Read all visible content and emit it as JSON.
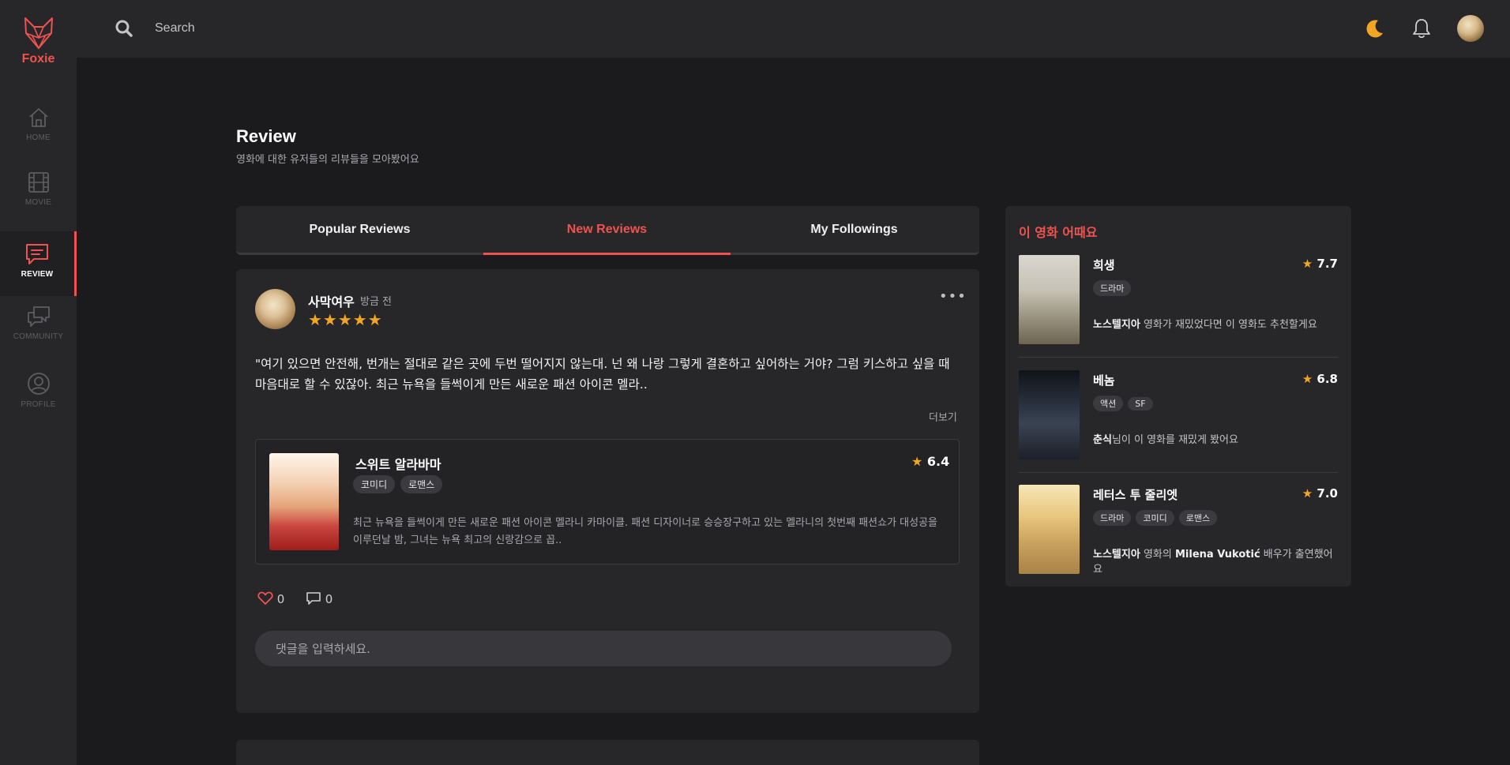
{
  "app": {
    "name": "Foxie"
  },
  "nav": {
    "home": "HOME",
    "movie": "MOVIE",
    "review": "REVIEW",
    "community": "COMMUNITY",
    "profile": "PROFILE"
  },
  "search": {
    "placeholder": "Search"
  },
  "colors": {
    "accent": "#ef5350",
    "star": "#f4a623",
    "background": "#1b1b1d",
    "card": "#27272a"
  },
  "header": {
    "title": "Review",
    "subtitle": "영화에 대한 유저들의 리뷰들을 모아봤어요"
  },
  "tabs": {
    "popular": "Popular Reviews",
    "new": "New Reviews",
    "following": "My Followings",
    "active": "New Reviews"
  },
  "review": {
    "username": "사막여우",
    "time": "방금 전",
    "stars": "★★★★★",
    "rating": 5,
    "text": "\"여기 있으면 안전해, 번개는 절대로 같은 곳에 두번 떨어지지 않는대. 넌 왜 나랑 그렇게 결혼하고 싶어하는 거야? 그럼 키스하고 싶을 때 마음대로 할 수 있잖아. 최근 뉴욕을 들썩이게 만든 새로운 패션 아이콘 멜라..",
    "more": "더보기",
    "movie": {
      "title": "스위트 알라바마",
      "rating": "6.4",
      "tags": [
        "코미디",
        "로맨스"
      ],
      "description": "최근 뉴욕을 들썩이게 만든 새로운 패션 아이콘 멜라니 카마이클. 패션 디자이너로 승승장구하고 있는 멜라니의 첫번째 패션쇼가 대성공을 이루던날 밤, 그녀는 뉴욕 최고의 신랑감으로 꼽.."
    },
    "likes": "0",
    "comments": "0",
    "comment_placeholder": "댓글을 입력하세요."
  },
  "recommend": {
    "title": "이 영화 어때요",
    "items": [
      {
        "title": "희생",
        "rating": "7.7",
        "tags": [
          "드라마"
        ],
        "reason_bold": "노스텔지아",
        "reason": " 영화가 재밌었다면 이 영화도 추천할게요"
      },
      {
        "title": "베놈",
        "rating": "6.8",
        "tags": [
          "액션",
          "SF"
        ],
        "reason_bold": "춘식",
        "reason": "님이 이 영화를 재밌게 봤어요"
      },
      {
        "title": "레터스 투 줄리엣",
        "rating": "7.0",
        "tags": [
          "드라마",
          "코미디",
          "로맨스"
        ],
        "reason_bold": "노스텔지아",
        "reason_mid": " 영화의 ",
        "reason_bold2": "Milena Vukotić",
        "reason_end": " 배우가 출연했어요"
      }
    ]
  }
}
